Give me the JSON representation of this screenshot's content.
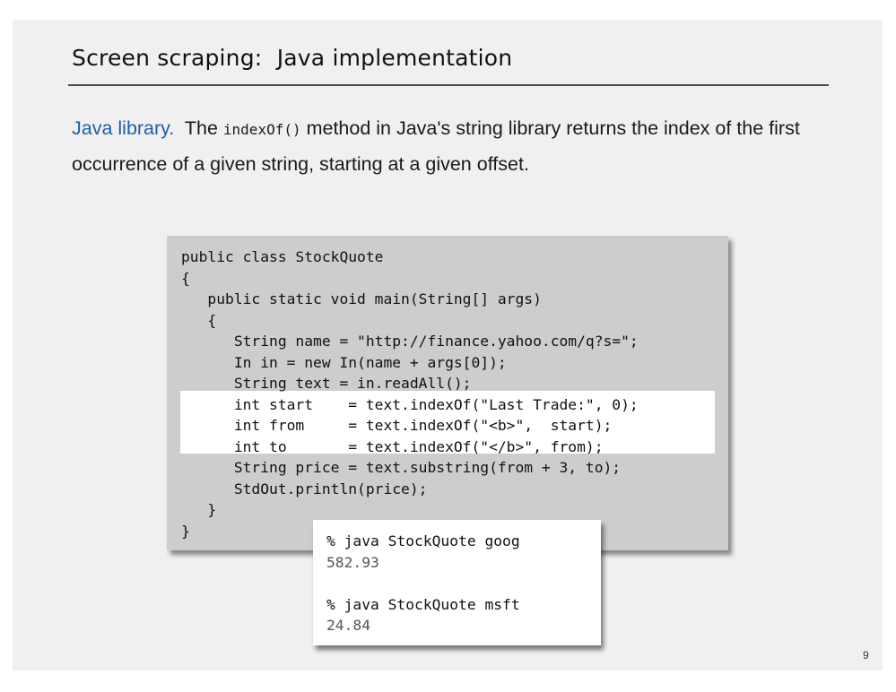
{
  "slide": {
    "title": "Screen scraping:  Java implementation",
    "page_number": "9",
    "paragraph": {
      "lead": "Java library.",
      "text_before_code": "  The ",
      "inline_code": "indexOf()",
      "text_after_code": " method in Java's string library returns the index of the first occurrence of a given string, starting at a given offset."
    },
    "colors": {
      "lead": "#1f5fa8",
      "code_box_bg": "#cdcdcd",
      "highlight_bg": "#ffffff",
      "slide_bg": "#f0f0f0"
    }
  },
  "code": {
    "lines": [
      "public class StockQuote",
      "{",
      "   public static void main(String[] args)",
      "   {",
      "      String name = \"http://finance.yahoo.com/q?s=\";",
      "      In in = new In(name + args[0]);",
      "      String text = in.readAll();",
      "      int start    = text.indexOf(\"Last Trade:\", 0);",
      "      int from     = text.indexOf(\"<b>\",  start);",
      "      int to       = text.indexOf(\"</b>\", from);",
      "      String price = text.substring(from + 3, to);",
      "      StdOut.println(price);",
      "   }",
      "}"
    ],
    "highlighted_lines": [
      7,
      8,
      9
    ]
  },
  "output": {
    "lines": [
      {
        "kind": "cmd",
        "text": "% java StockQuote goog"
      },
      {
        "kind": "result",
        "text": "582.93"
      },
      {
        "kind": "blank",
        "text": ""
      },
      {
        "kind": "cmd",
        "text": "% java StockQuote msft"
      },
      {
        "kind": "result",
        "text": "24.84"
      }
    ]
  }
}
